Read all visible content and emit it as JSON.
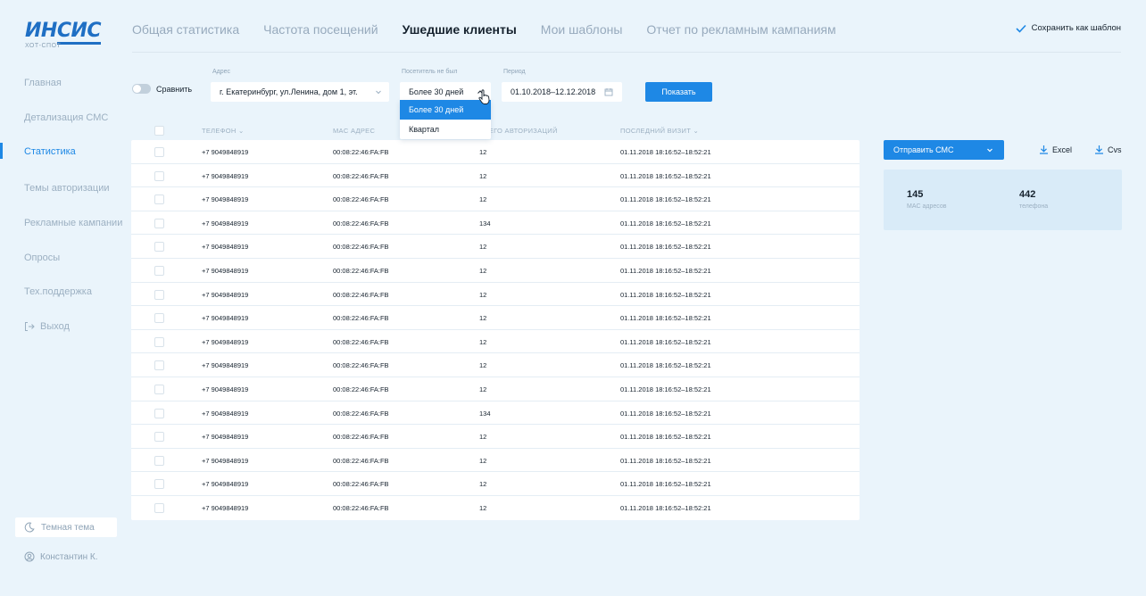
{
  "logo": {
    "text_a": "ИН",
    "text_b": "СИС",
    "sub": "ХОТ-СПОТ"
  },
  "topnav": {
    "tabs": [
      {
        "label": "Общая статистика"
      },
      {
        "label": "Частота посещений"
      },
      {
        "label": "Ушедшие клиенты",
        "active": true
      },
      {
        "label": "Мои шаблоны"
      },
      {
        "label": "Отчет по рекламным кампаниям"
      }
    ],
    "save_template": "Сохранить как шаблон"
  },
  "sidebar": {
    "items": [
      {
        "label": "Главная"
      },
      {
        "label": "Детализация СМС"
      },
      {
        "label": "Статистика",
        "active": true
      },
      {
        "label": "Темы авторизации"
      },
      {
        "label": "Рекламные кампании"
      },
      {
        "label": "Опросы"
      },
      {
        "label": "Тех.поддержка"
      }
    ],
    "exit": "Выход",
    "dark_theme": "Темная тема",
    "user": "Константин К."
  },
  "filters": {
    "compare": "Сравнить",
    "address_label": "Адрес",
    "address_value": "г. Екатеринбург, ул.Ленина, дом 1, эт.",
    "visitor_label": "Посетитель не был",
    "visitor_value": "Более 30 дней",
    "visitor_options": [
      "Более 30 дней",
      "Квартал"
    ],
    "period_label": "Период",
    "period_value": "01.10.2018–12.12.2018",
    "show_button": "Показать"
  },
  "table": {
    "headers": {
      "phone": "ТЕЛЕФОН",
      "mac": "MAC АДРЕС",
      "auth": "ВСЕГО АВТОРИЗАЦИЙ",
      "last": "ПОСЛЕДНИЙ ВИЗИТ"
    },
    "rows": [
      {
        "phone": "+7 9049848919",
        "mac": "00:08:22:46:FA:FB",
        "auth": "12",
        "last": "01.11.2018 18:16:52–18:52:21"
      },
      {
        "phone": "+7 9049848919",
        "mac": "00:08:22:46:FA:FB",
        "auth": "12",
        "last": "01.11.2018 18:16:52–18:52:21"
      },
      {
        "phone": "+7 9049848919",
        "mac": "00:08:22:46:FA:FB",
        "auth": "12",
        "last": "01.11.2018 18:16:52–18:52:21"
      },
      {
        "phone": "+7 9049848919",
        "mac": "00:08:22:46:FA:FB",
        "auth": "134",
        "last": "01.11.2018 18:16:52–18:52:21"
      },
      {
        "phone": "+7 9049848919",
        "mac": "00:08:22:46:FA:FB",
        "auth": "12",
        "last": "01.11.2018 18:16:52–18:52:21"
      },
      {
        "phone": "+7 9049848919",
        "mac": "00:08:22:46:FA:FB",
        "auth": "12",
        "last": "01.11.2018 18:16:52–18:52:21"
      },
      {
        "phone": "+7 9049848919",
        "mac": "00:08:22:46:FA:FB",
        "auth": "12",
        "last": "01.11.2018 18:16:52–18:52:21"
      },
      {
        "phone": "+7 9049848919",
        "mac": "00:08:22:46:FA:FB",
        "auth": "12",
        "last": "01.11.2018 18:16:52–18:52:21"
      },
      {
        "phone": "+7 9049848919",
        "mac": "00:08:22:46:FA:FB",
        "auth": "12",
        "last": "01.11.2018 18:16:52–18:52:21"
      },
      {
        "phone": "+7 9049848919",
        "mac": "00:08:22:46:FA:FB",
        "auth": "12",
        "last": "01.11.2018 18:16:52–18:52:21"
      },
      {
        "phone": "+7 9049848919",
        "mac": "00:08:22:46:FA:FB",
        "auth": "12",
        "last": "01.11.2018 18:16:52–18:52:21"
      },
      {
        "phone": "+7 9049848919",
        "mac": "00:08:22:46:FA:FB",
        "auth": "134",
        "last": "01.11.2018 18:16:52–18:52:21"
      },
      {
        "phone": "+7 9049848919",
        "mac": "00:08:22:46:FA:FB",
        "auth": "12",
        "last": "01.11.2018 18:16:52–18:52:21"
      },
      {
        "phone": "+7 9049848919",
        "mac": "00:08:22:46:FA:FB",
        "auth": "12",
        "last": "01.11.2018 18:16:52–18:52:21"
      },
      {
        "phone": "+7 9049848919",
        "mac": "00:08:22:46:FA:FB",
        "auth": "12",
        "last": "01.11.2018 18:16:52–18:52:21"
      },
      {
        "phone": "+7 9049848919",
        "mac": "00:08:22:46:FA:FB",
        "auth": "12",
        "last": "01.11.2018 18:16:52–18:52:21"
      }
    ]
  },
  "actions": {
    "send_sms": "Отправить СМС",
    "excel": "Excel",
    "cvs": "Cvs"
  },
  "stats": {
    "mac_count": "145",
    "mac_label": "MAC адресов",
    "phone_count": "442",
    "phone_label": "телефона"
  },
  "colors": {
    "accent": "#1e88e5",
    "background": "#eaf4fb",
    "logo": "#1f6fc4"
  }
}
